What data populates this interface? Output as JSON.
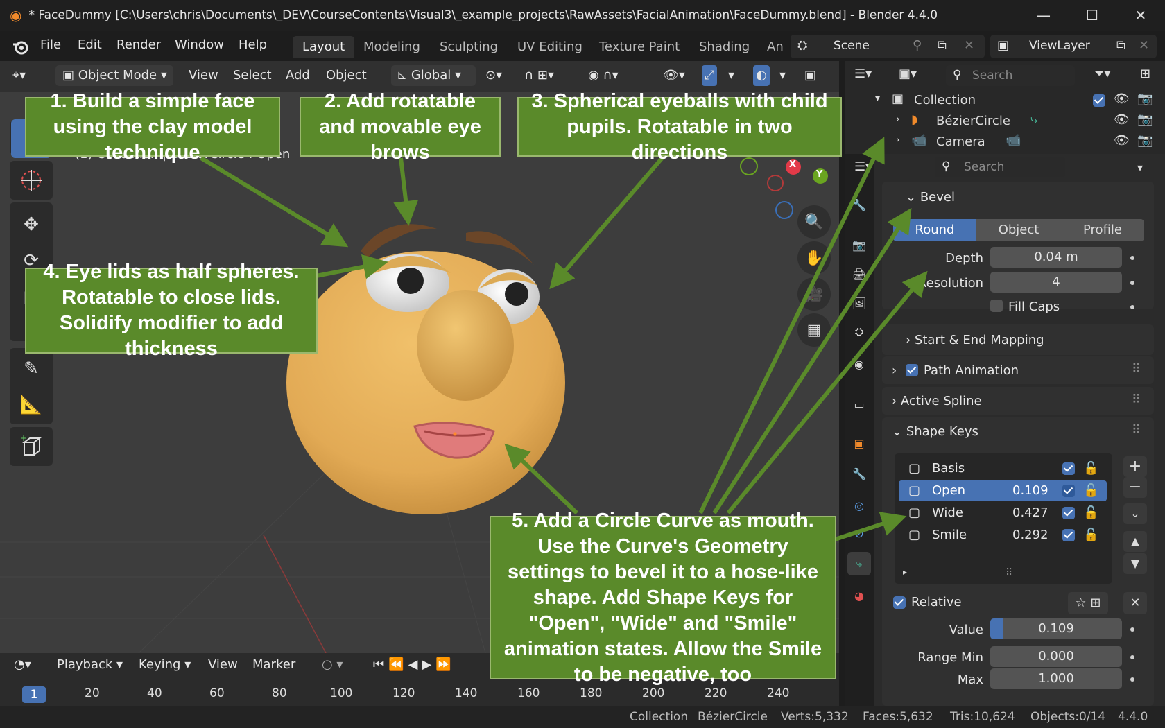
{
  "window": {
    "title": "* FaceDummy [C:\\Users\\chris\\Documents\\_DEV\\CourseContents\\Visual3\\_example_projects\\RawAssets\\FacialAnimation\\FaceDummy.blend] - Blender 4.4.0",
    "controls": [
      "minimize-icon",
      "maximize-icon",
      "close-icon"
    ]
  },
  "menu": [
    "File",
    "Edit",
    "Render",
    "Window",
    "Help"
  ],
  "workspaces": [
    "Layout",
    "Modeling",
    "Sculpting",
    "UV Editing",
    "Texture Paint",
    "Shading",
    "An"
  ],
  "scene": {
    "name": "Scene",
    "view_layer": "ViewLayer"
  },
  "viewport_header": {
    "mode": "Object Mode",
    "view": "View",
    "select": "Select",
    "add": "Add",
    "object": "Object",
    "orientation": "Global"
  },
  "viewport": {
    "info": "(1) Collection | BézierCircle : Open",
    "gizmo": {
      "x": "X",
      "y": "Y"
    }
  },
  "outliner": {
    "search_placeholder": "Search",
    "collection": "Collection",
    "items": [
      "BézierCircle",
      "Camera"
    ]
  },
  "properties": {
    "search_placeholder": "Search",
    "bevel": {
      "title": "Bevel",
      "tabs": [
        "Round",
        "Object",
        "Profile"
      ],
      "active_tab": "Round",
      "depth_label": "Depth",
      "depth": "0.04 m",
      "resolution_label": "Resolution",
      "resolution": "4",
      "fill_caps": "Fill Caps"
    },
    "start_end_mapping": "Start & End Mapping",
    "path_animation": "Path Animation",
    "active_spline": "Active Spline",
    "shape_keys": {
      "title": "Shape Keys",
      "keys": [
        {
          "name": "Basis",
          "value": ""
        },
        {
          "name": "Open",
          "value": "0.109"
        },
        {
          "name": "Wide",
          "value": "0.427"
        },
        {
          "name": "Smile",
          "value": "0.292"
        }
      ],
      "selected": "Open",
      "relative": "Relative",
      "value_label": "Value",
      "value": "0.109",
      "range_min_label": "Range Min",
      "range_min": "0.000",
      "max_label": "Max",
      "max": "1.000"
    }
  },
  "timeline": {
    "playback": "Playback",
    "keying": "Keying",
    "view": "View",
    "marker": "Marker",
    "current_frame": "1",
    "frames": [
      "20",
      "40",
      "60",
      "80",
      "100",
      "120",
      "140",
      "160",
      "180",
      "200",
      "220",
      "240"
    ]
  },
  "status": {
    "collection": "Collection",
    "object": "BézierCircle",
    "verts": "Verts:5,332",
    "faces": "Faces:5,632",
    "tris": "Tris:10,624",
    "objects": "Objects:0/14",
    "version": "4.4.0"
  },
  "callouts": {
    "c1": "1. Build a simple face using the clay model technique",
    "c2": "2. Add rotatable and movable eye brows",
    "c3": "3. Spherical eyeballs with child pupils. Rotatable in two directions",
    "c4": "4. Eye lids as half spheres. Rotatable to close lids. Solidify modifier to add thickness",
    "c5": "5. Add a Circle Curve as mouth. Use the Curve's Geometry settings to bevel it to a hose-like shape. Add Shape Keys for \"Open\", \"Wide\" and \"Smile\" animation states. Allow the Smile to be negative, too"
  },
  "colors": {
    "callout_bg": "#5a8a2a",
    "arrow": "#5a8a2a",
    "accent": "#4772b3",
    "face": "#e2aa55"
  }
}
